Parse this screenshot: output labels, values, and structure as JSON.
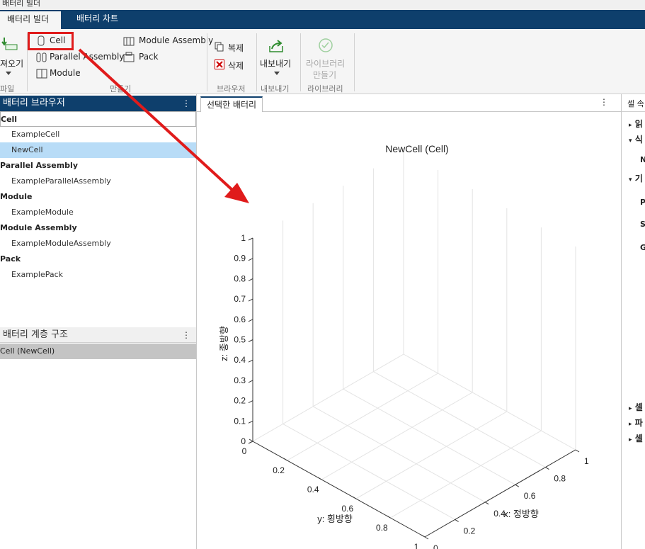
{
  "window": {
    "title": "배터리 빌더"
  },
  "tabs": [
    {
      "label": "배터리 빌더"
    },
    {
      "label": "배터리 차트"
    }
  ],
  "ribbon": {
    "file": {
      "import_label_1": "져오기",
      "section": "파일"
    },
    "create": {
      "cell": "Cell",
      "parallel_assembly": "Parallel Assembly",
      "module": "Module",
      "module_assembly": "Module Assembly",
      "pack": "Pack",
      "section": "만들기"
    },
    "browser": {
      "copy": "복제",
      "delete": "삭제",
      "section": "브라우저"
    },
    "export": {
      "label": "내보내기",
      "section": "내보내기"
    },
    "library": {
      "label_1": "라이브러리",
      "label_2": "만들기",
      "section": "라이브러리"
    }
  },
  "browser_panel": {
    "title": "배터리 브라우저",
    "items": [
      {
        "label": "Cell",
        "type": "group"
      },
      {
        "label": "ExampleCell",
        "type": "leaf"
      },
      {
        "label": "NewCell",
        "type": "leaf",
        "selected": true
      },
      {
        "label": "Parallel Assembly",
        "type": "group"
      },
      {
        "label": "ExampleParallelAssembly",
        "type": "leaf"
      },
      {
        "label": "Module",
        "type": "group"
      },
      {
        "label": "ExampleModule",
        "type": "leaf"
      },
      {
        "label": "Module Assembly",
        "type": "group"
      },
      {
        "label": "ExampleModuleAssembly",
        "type": "leaf"
      },
      {
        "label": "Pack",
        "type": "group"
      },
      {
        "label": "ExamplePack",
        "type": "leaf"
      }
    ]
  },
  "hierarchy_panel": {
    "title": "배터리 계층 구조",
    "item": "Cell (NewCell)"
  },
  "center": {
    "tab_label": "선택한 배터리"
  },
  "chart_data": {
    "type": "3d-axes",
    "title": "NewCell (Cell)",
    "xlabel": "x: 정방향",
    "ylabel": "y: 횡방향",
    "zlabel": "z: 종방향",
    "xlim": [
      0,
      1
    ],
    "ylim": [
      0,
      1
    ],
    "zlim": [
      0,
      1
    ],
    "x_ticks": [
      "0",
      "0.2",
      "0.4",
      "0.6",
      "0.8",
      "1"
    ],
    "y_ticks": [
      "0",
      "0.2",
      "0.4",
      "0.6",
      "0.8",
      "1"
    ],
    "z_ticks": [
      "0",
      "0.1",
      "0.2",
      "0.3",
      "0.4",
      "0.5",
      "0.6",
      "0.7",
      "0.8",
      "0.9",
      "1"
    ],
    "grid": true,
    "series": []
  },
  "right_panel": {
    "title": "셀 속",
    "items": [
      "읽",
      "식",
      "N",
      "기",
      "P",
      "S",
      "G",
      "셀",
      "파",
      "셀"
    ]
  },
  "colors": {
    "accent": "#0e3f6c",
    "highlight": "#e01b1b",
    "selection": "#b8dcf7"
  }
}
